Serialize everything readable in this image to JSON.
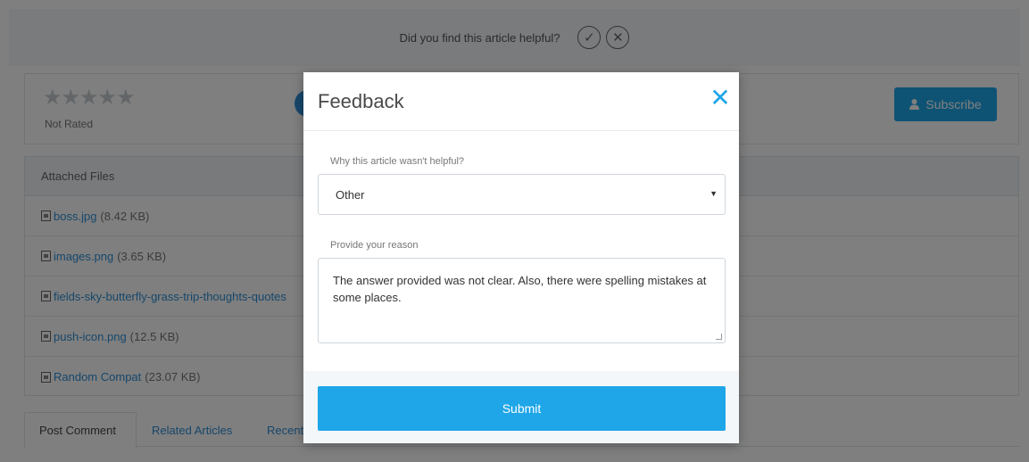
{
  "helpful": {
    "question": "Did you find this article helpful?",
    "yes_icon": "✓",
    "no_icon": "✕"
  },
  "rating": {
    "stars": "★★★★★",
    "status": "Not Rated",
    "subscribe_label": "Subscribe",
    "subscribe_icon": "user-icon"
  },
  "files": {
    "header": "Attached Files",
    "items": [
      {
        "name": "boss.jpg",
        "size": "(8.42 KB)"
      },
      {
        "name": "images.png",
        "size": "(3.65 KB)"
      },
      {
        "name": "fields-sky-butterfly-grass-trip-thoughts-quotes",
        "size": ""
      },
      {
        "name": "push-icon.png",
        "size": "(12.5 KB)"
      },
      {
        "name": "Random Compat",
        "size": "(23.07 KB)"
      }
    ]
  },
  "tabs": [
    {
      "label": "Post Comment"
    },
    {
      "label": "Related Articles"
    },
    {
      "label": "Recent"
    }
  ],
  "modal": {
    "title": "Feedback",
    "close_icon": "✕",
    "reason_label": "Why this article wasn't helpful?",
    "reason_value": "Other",
    "comment_label": "Provide your reason",
    "comment_value": "The answer provided was not clear. Also, there were spelling mistakes at some places.",
    "submit_label": "Submit"
  },
  "colors": {
    "accent": "#1ea6e8",
    "link": "#2d8ed6"
  }
}
